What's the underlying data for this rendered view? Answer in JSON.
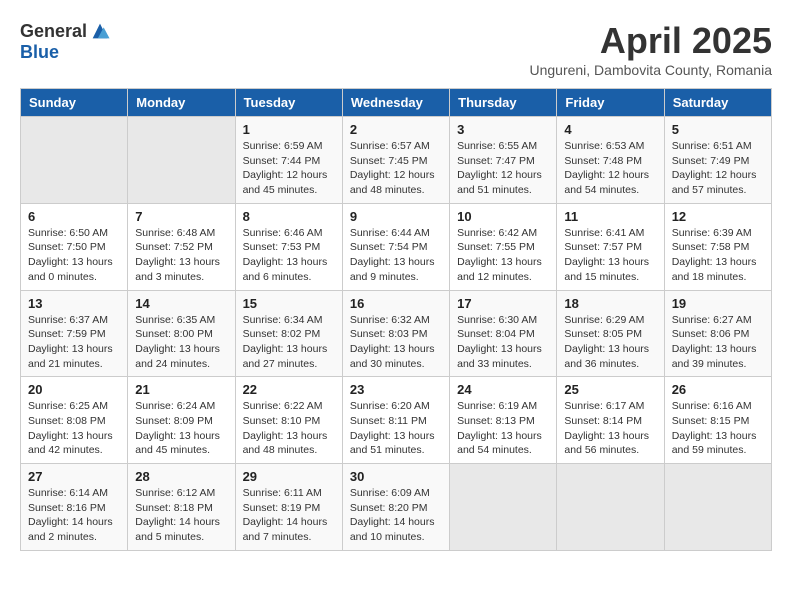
{
  "logo": {
    "general": "General",
    "blue": "Blue"
  },
  "title": "April 2025",
  "subtitle": "Ungureni, Dambovita County, Romania",
  "days_of_week": [
    "Sunday",
    "Monday",
    "Tuesday",
    "Wednesday",
    "Thursday",
    "Friday",
    "Saturday"
  ],
  "weeks": [
    [
      {
        "day": "",
        "info": ""
      },
      {
        "day": "",
        "info": ""
      },
      {
        "day": "1",
        "info": "Sunrise: 6:59 AM\nSunset: 7:44 PM\nDaylight: 12 hours and 45 minutes."
      },
      {
        "day": "2",
        "info": "Sunrise: 6:57 AM\nSunset: 7:45 PM\nDaylight: 12 hours and 48 minutes."
      },
      {
        "day": "3",
        "info": "Sunrise: 6:55 AM\nSunset: 7:47 PM\nDaylight: 12 hours and 51 minutes."
      },
      {
        "day": "4",
        "info": "Sunrise: 6:53 AM\nSunset: 7:48 PM\nDaylight: 12 hours and 54 minutes."
      },
      {
        "day": "5",
        "info": "Sunrise: 6:51 AM\nSunset: 7:49 PM\nDaylight: 12 hours and 57 minutes."
      }
    ],
    [
      {
        "day": "6",
        "info": "Sunrise: 6:50 AM\nSunset: 7:50 PM\nDaylight: 13 hours and 0 minutes."
      },
      {
        "day": "7",
        "info": "Sunrise: 6:48 AM\nSunset: 7:52 PM\nDaylight: 13 hours and 3 minutes."
      },
      {
        "day": "8",
        "info": "Sunrise: 6:46 AM\nSunset: 7:53 PM\nDaylight: 13 hours and 6 minutes."
      },
      {
        "day": "9",
        "info": "Sunrise: 6:44 AM\nSunset: 7:54 PM\nDaylight: 13 hours and 9 minutes."
      },
      {
        "day": "10",
        "info": "Sunrise: 6:42 AM\nSunset: 7:55 PM\nDaylight: 13 hours and 12 minutes."
      },
      {
        "day": "11",
        "info": "Sunrise: 6:41 AM\nSunset: 7:57 PM\nDaylight: 13 hours and 15 minutes."
      },
      {
        "day": "12",
        "info": "Sunrise: 6:39 AM\nSunset: 7:58 PM\nDaylight: 13 hours and 18 minutes."
      }
    ],
    [
      {
        "day": "13",
        "info": "Sunrise: 6:37 AM\nSunset: 7:59 PM\nDaylight: 13 hours and 21 minutes."
      },
      {
        "day": "14",
        "info": "Sunrise: 6:35 AM\nSunset: 8:00 PM\nDaylight: 13 hours and 24 minutes."
      },
      {
        "day": "15",
        "info": "Sunrise: 6:34 AM\nSunset: 8:02 PM\nDaylight: 13 hours and 27 minutes."
      },
      {
        "day": "16",
        "info": "Sunrise: 6:32 AM\nSunset: 8:03 PM\nDaylight: 13 hours and 30 minutes."
      },
      {
        "day": "17",
        "info": "Sunrise: 6:30 AM\nSunset: 8:04 PM\nDaylight: 13 hours and 33 minutes."
      },
      {
        "day": "18",
        "info": "Sunrise: 6:29 AM\nSunset: 8:05 PM\nDaylight: 13 hours and 36 minutes."
      },
      {
        "day": "19",
        "info": "Sunrise: 6:27 AM\nSunset: 8:06 PM\nDaylight: 13 hours and 39 minutes."
      }
    ],
    [
      {
        "day": "20",
        "info": "Sunrise: 6:25 AM\nSunset: 8:08 PM\nDaylight: 13 hours and 42 minutes."
      },
      {
        "day": "21",
        "info": "Sunrise: 6:24 AM\nSunset: 8:09 PM\nDaylight: 13 hours and 45 minutes."
      },
      {
        "day": "22",
        "info": "Sunrise: 6:22 AM\nSunset: 8:10 PM\nDaylight: 13 hours and 48 minutes."
      },
      {
        "day": "23",
        "info": "Sunrise: 6:20 AM\nSunset: 8:11 PM\nDaylight: 13 hours and 51 minutes."
      },
      {
        "day": "24",
        "info": "Sunrise: 6:19 AM\nSunset: 8:13 PM\nDaylight: 13 hours and 54 minutes."
      },
      {
        "day": "25",
        "info": "Sunrise: 6:17 AM\nSunset: 8:14 PM\nDaylight: 13 hours and 56 minutes."
      },
      {
        "day": "26",
        "info": "Sunrise: 6:16 AM\nSunset: 8:15 PM\nDaylight: 13 hours and 59 minutes."
      }
    ],
    [
      {
        "day": "27",
        "info": "Sunrise: 6:14 AM\nSunset: 8:16 PM\nDaylight: 14 hours and 2 minutes."
      },
      {
        "day": "28",
        "info": "Sunrise: 6:12 AM\nSunset: 8:18 PM\nDaylight: 14 hours and 5 minutes."
      },
      {
        "day": "29",
        "info": "Sunrise: 6:11 AM\nSunset: 8:19 PM\nDaylight: 14 hours and 7 minutes."
      },
      {
        "day": "30",
        "info": "Sunrise: 6:09 AM\nSunset: 8:20 PM\nDaylight: 14 hours and 10 minutes."
      },
      {
        "day": "",
        "info": ""
      },
      {
        "day": "",
        "info": ""
      },
      {
        "day": "",
        "info": ""
      }
    ]
  ]
}
